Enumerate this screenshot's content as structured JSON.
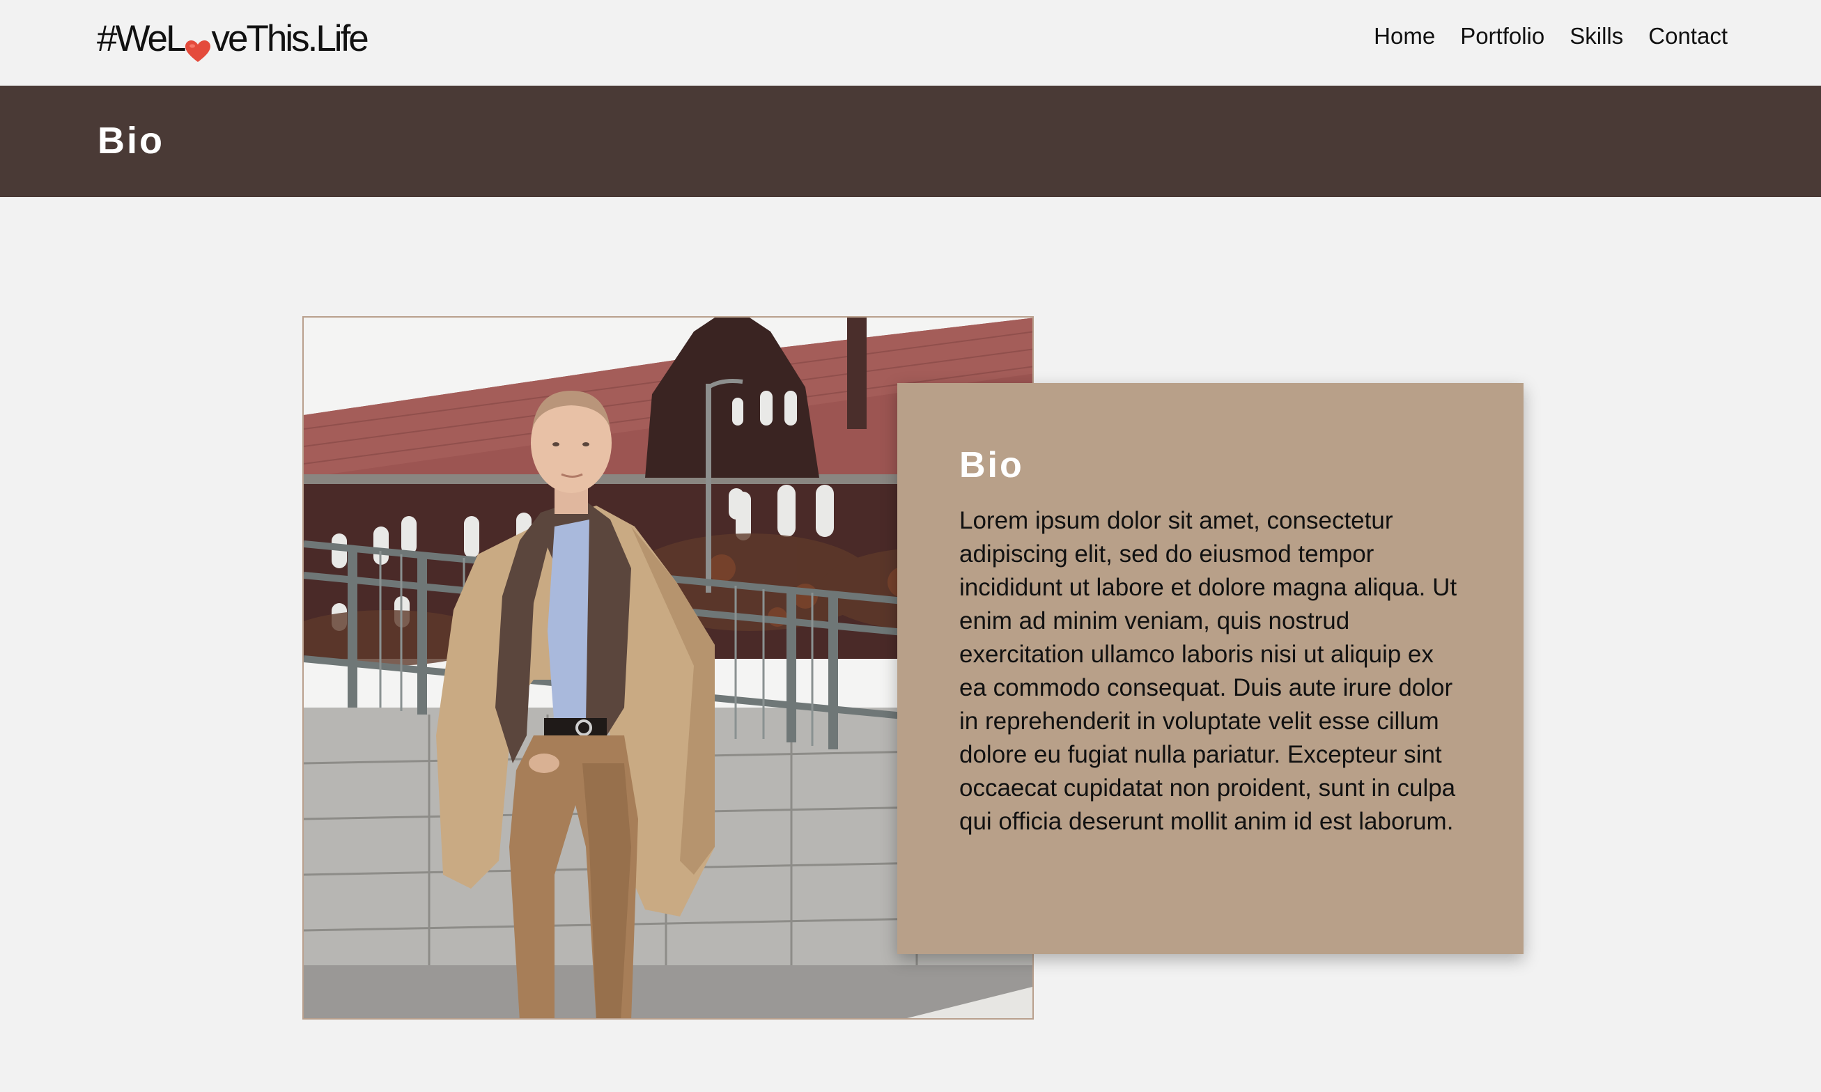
{
  "site": {
    "logo_prefix": "#WeL",
    "logo_suffix": "veThis.Life",
    "logo_heart_icon": "heart-icon",
    "heart_color": "#e44b3c"
  },
  "nav": {
    "items": [
      {
        "label": "Home"
      },
      {
        "label": "Portfolio"
      },
      {
        "label": "Skills"
      },
      {
        "label": "Contact"
      }
    ]
  },
  "page": {
    "title": "Bio",
    "band_color": "#4a3a36"
  },
  "bio": {
    "heading": "Bio",
    "text": "Lorem ipsum dolor sit amet, consectetur adipiscing elit, sed do eiusmod tempor incididunt ut labore et dolore magna aliqua. Ut enim ad minim veniam, quis nostrud exercitation ullamco laboris nisi ut aliquip ex ea commodo consequat. Duis aute irure dolor in reprehenderit in voluptate velit esse cillum dolore eu fugiat nulla pariatur. Excepteur sint occaecat cupidatat non proident, sunt in culpa qui officia deserunt mollit anim id est laborum.",
    "card_color": "#b8a089"
  }
}
